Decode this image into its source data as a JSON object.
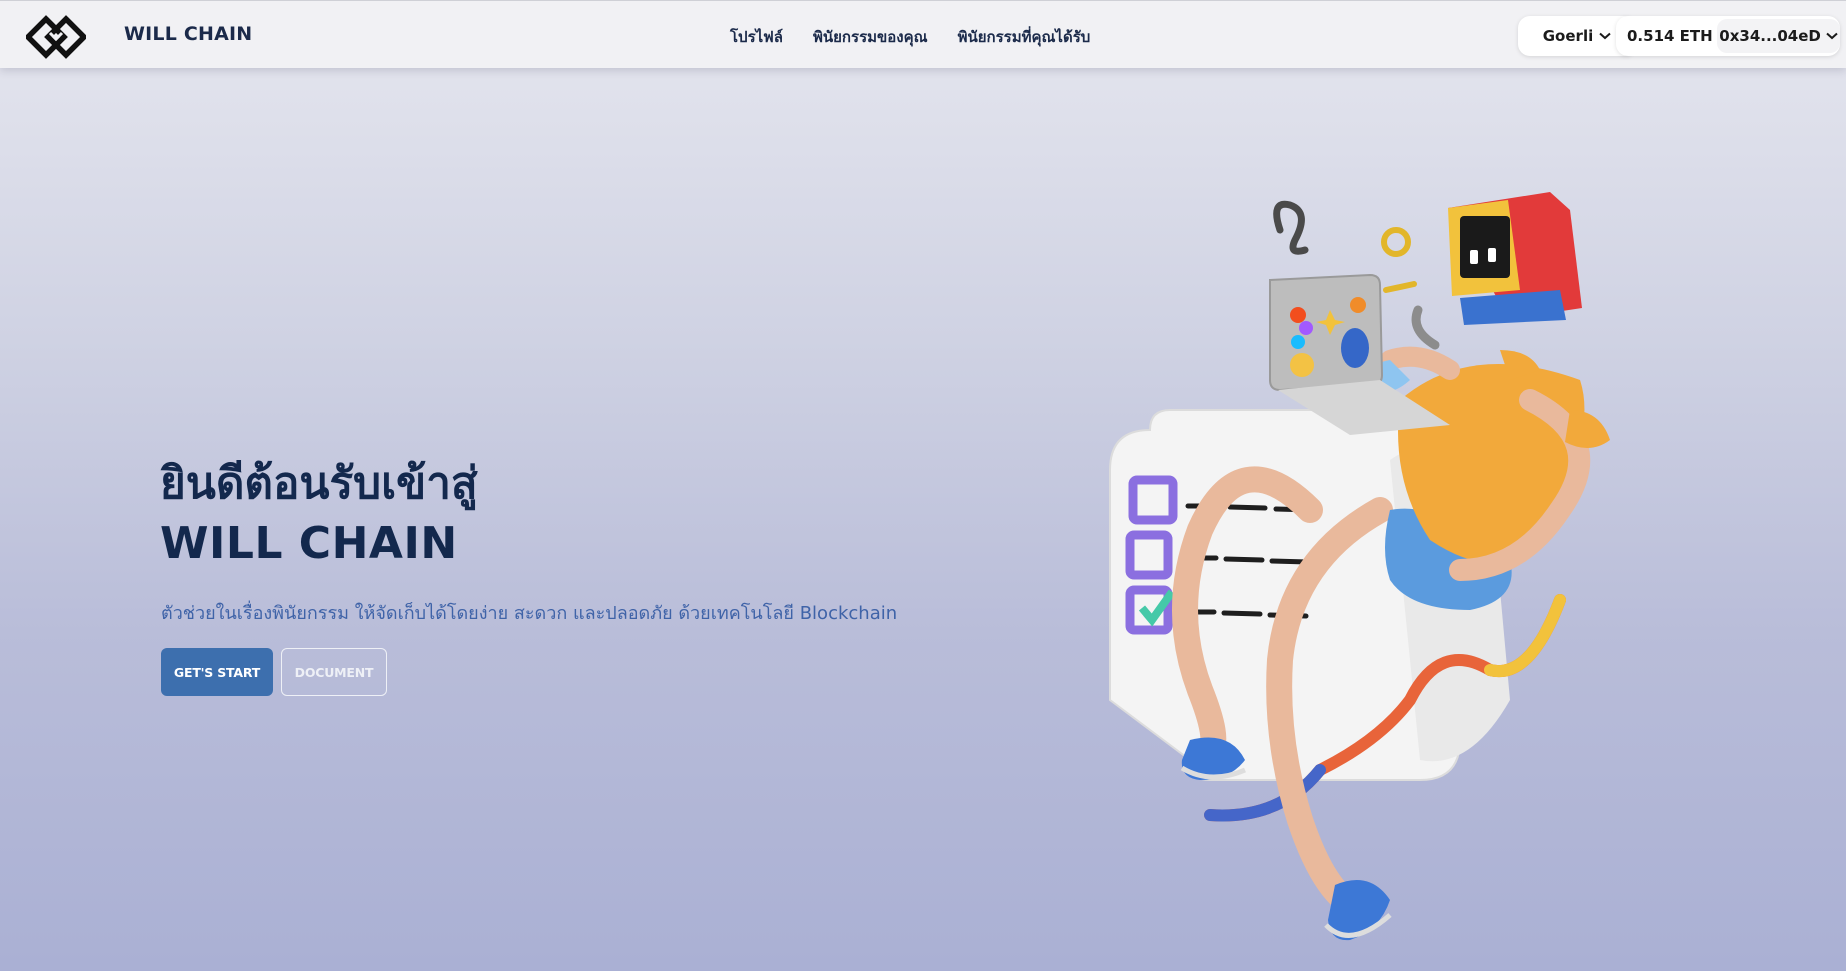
{
  "header": {
    "brand": "WILL CHAIN",
    "nav": [
      "โปรไฟล์",
      "พินัยกรรมของคุณ",
      "พินัยกรรมที่คุณได้รับ"
    ],
    "network": "Goerli",
    "balance": "0.514 ETH",
    "address": "0x34...04eD"
  },
  "hero": {
    "title_line1": "ยินดีต้อนรับเข้าสู่",
    "title_line2": "WILL CHAIN",
    "subtitle": "ตัวช่วยในเรื่องพินัยกรรม ให้จัดเก็บได้โดยง่าย สะดวก และปลอดภัย ด้วยเทคโนโลยี Blockchain",
    "primary_button": "GET'S START",
    "secondary_button": "DOCUMENT"
  },
  "colors": {
    "navy": "#13284d",
    "accent_blue": "#3d6fae",
    "subtitle_blue": "#3f63a8"
  },
  "icons": [
    "logo-icon",
    "chevron-down-icon",
    "character-illustration"
  ]
}
